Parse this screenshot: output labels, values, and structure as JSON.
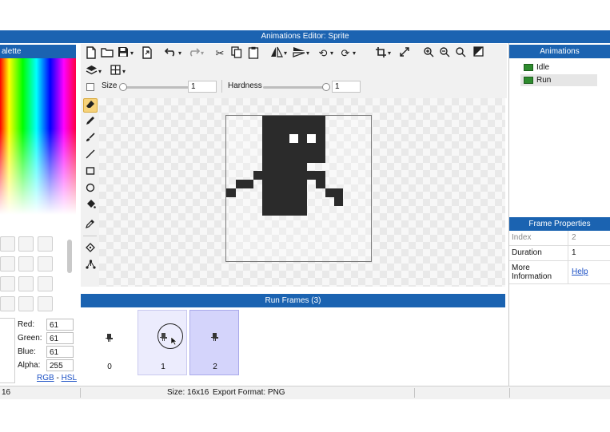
{
  "window": {
    "title": "Animations Editor: Sprite"
  },
  "palette": {
    "title": "alette",
    "red_label": "Red:",
    "red": "61",
    "green_label": "Green:",
    "green": "61",
    "blue_label": "Blue:",
    "blue": "61",
    "alpha_label": "Alpha:",
    "alpha": "255",
    "rgb_link": "RGB",
    "link_sep": " - ",
    "hsl_link": "HSL"
  },
  "toolbar": {
    "size_label": "Size",
    "size_value": "1",
    "hardness_label": "Hardness",
    "hardness_value": "1",
    "icons": [
      "new-icon",
      "open-icon",
      "save-icon",
      "export-icon",
      "layers-icon",
      "grid-icon",
      "undo-icon",
      "redo-icon",
      "cut-icon",
      "copy-icon",
      "paste-icon",
      "flip-icon",
      "mirror-icon",
      "rotate-left-icon",
      "rotate-right-icon",
      "crop-icon",
      "resize-icon",
      "zoom-in-icon",
      "zoom-out-icon",
      "zoom-fit-icon",
      "fill-icon"
    ]
  },
  "tools": [
    "eraser-icon",
    "pencil-icon",
    "brush-icon",
    "line-icon",
    "rectangle-icon",
    "ellipse-icon",
    "bucket-icon",
    "eyedropper-icon",
    "select-icon",
    "nodes-icon"
  ],
  "animations": {
    "title": "Animations",
    "items": [
      {
        "label": "Idle"
      },
      {
        "label": "Run"
      }
    ],
    "selected": "Run"
  },
  "frame_properties": {
    "title": "Frame Properties",
    "rows": [
      {
        "key": "Index",
        "value": "2"
      },
      {
        "key": "Duration",
        "value": "1"
      },
      {
        "key_line1": "More",
        "key_line2": "Information",
        "link": "Help"
      }
    ]
  },
  "run_frames": {
    "title": "Run Frames (3)",
    "frames": [
      {
        "index": "0"
      },
      {
        "index": "1"
      },
      {
        "index": "2"
      }
    ],
    "selected_index": "2"
  },
  "status": {
    "left": "16",
    "size": "Size: 16x16",
    "format": "Export Format: PNG"
  },
  "colors": {
    "accent": "#1b63b1",
    "sprite": "#2b2b2b",
    "selected_frame": "#d4d4fb",
    "hover_frame": "#ececff",
    "link": "#1a4fc4"
  }
}
